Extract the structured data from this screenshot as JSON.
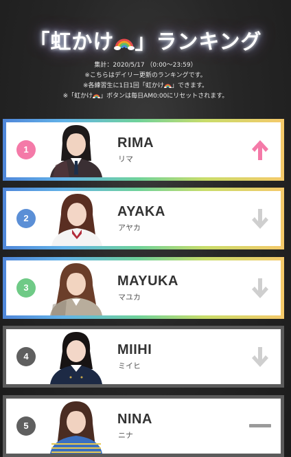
{
  "header": {
    "title_before": "「虹かけ",
    "title_after": "」ランキング",
    "title_icon": "rainbow-icon",
    "notes": [
      {
        "text": "集計：2020/5/17 （0:00〜23:59）"
      },
      {
        "text": "※こちらはデイリー更新のランキングです。"
      },
      {
        "before": "※各練習生に1日1回「虹かけ",
        "after": "」できます。",
        "icon": "rainbow-icon"
      },
      {
        "before": "※「虹かけ",
        "after": "」ボタンは毎日AM0:00にリセットされます。",
        "icon": "rainbow-icon"
      }
    ]
  },
  "ranking": [
    {
      "rank": "1",
      "name": "RIMA",
      "kana": "リマ",
      "trend": "up",
      "trend_icon": "arrow-up-icon",
      "badge_color": "#f47aa8",
      "frame": "rainbow"
    },
    {
      "rank": "2",
      "name": "AYAKA",
      "kana": "アヤカ",
      "trend": "down",
      "trend_icon": "arrow-down-icon",
      "badge_color": "#5b8fd6",
      "frame": "rainbow"
    },
    {
      "rank": "3",
      "name": "MAYUKA",
      "kana": "マユカ",
      "trend": "down",
      "trend_icon": "arrow-down-icon",
      "badge_color": "#6fca86",
      "frame": "rainbow"
    },
    {
      "rank": "4",
      "name": "MIIHI",
      "kana": "ミイヒ",
      "trend": "down",
      "trend_icon": "arrow-down-icon",
      "badge_color": "#5f5f5f",
      "frame": "gray"
    },
    {
      "rank": "5",
      "name": "NINA",
      "kana": "ニナ",
      "trend": "same",
      "trend_icon": "dash-icon",
      "badge_color": "#5f5f5f",
      "frame": "gray"
    }
  ],
  "colors": {
    "trend_up": "#f47aa8",
    "trend_down": "#cfcfcf",
    "trend_same": "#9a9a9a"
  }
}
